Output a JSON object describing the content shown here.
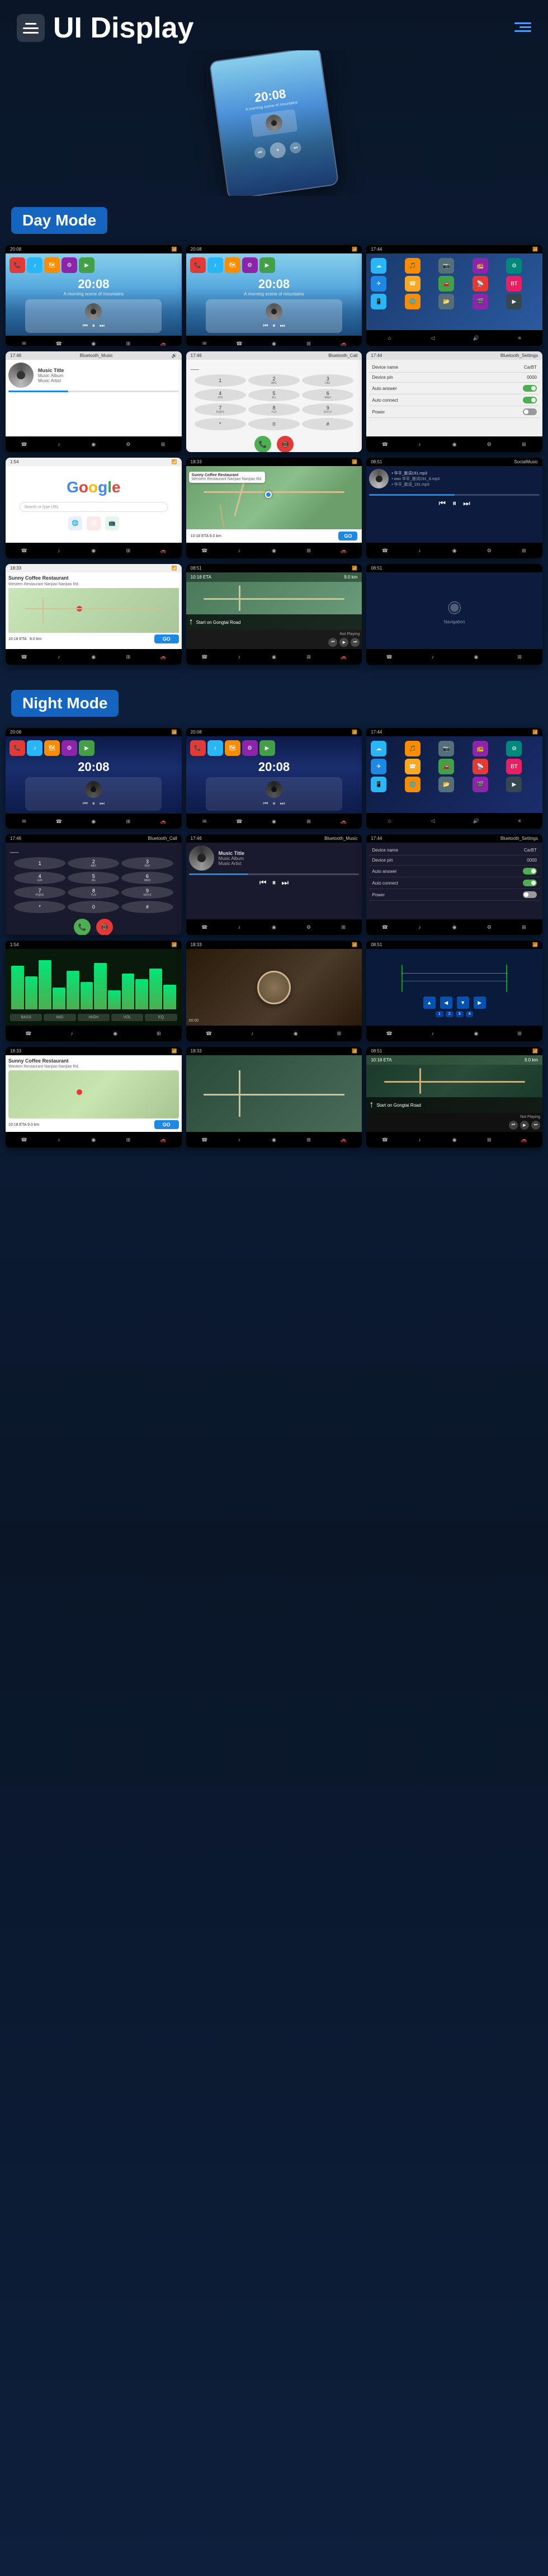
{
  "header": {
    "title": "UI Display",
    "menu_icon": "menu-icon",
    "nav_icon": "nav-icon"
  },
  "sections": {
    "day_mode": "Day Mode",
    "night_mode": "Night Mode"
  },
  "time": "20:08",
  "date": "A morning scene of mountains",
  "music": {
    "title": "Music Title",
    "album": "Music Album",
    "artist": "Music Artist"
  },
  "settings": {
    "device_name_label": "Device name",
    "device_name_value": "CarBT",
    "device_pin_label": "Device pin",
    "device_pin_value": "0000",
    "auto_answer_label": "Auto answer",
    "auto_connect_label": "Auto connect",
    "power_label": "Power"
  },
  "navigation": {
    "eta": "10:18 ETA",
    "distance": "9.0 km",
    "instruction": "Start on Gongtai Road",
    "not_playing": "Not Playing"
  },
  "poi": {
    "name": "Sunny Coffee Restaurant",
    "address": "Western Restaurant Nanjiao Nanjiao Rd.",
    "go_label": "GO",
    "eta_label": "10:18 ETA",
    "distance_label": "9.0 km"
  },
  "bluetooth": {
    "music_label": "Bluetooth_Music",
    "call_label": "Bluetooth_Call"
  },
  "local_files": {
    "items": [
      "华平_歌词191.mp3",
      "wav 华平_歌词191_d.mp3",
      "华平_歌词_191.mp3"
    ]
  },
  "toolbar_icons": {
    "phone": "☎",
    "music": "♪",
    "map": "◉",
    "settings": "⚙",
    "apps": "⊞",
    "back": "◁"
  }
}
